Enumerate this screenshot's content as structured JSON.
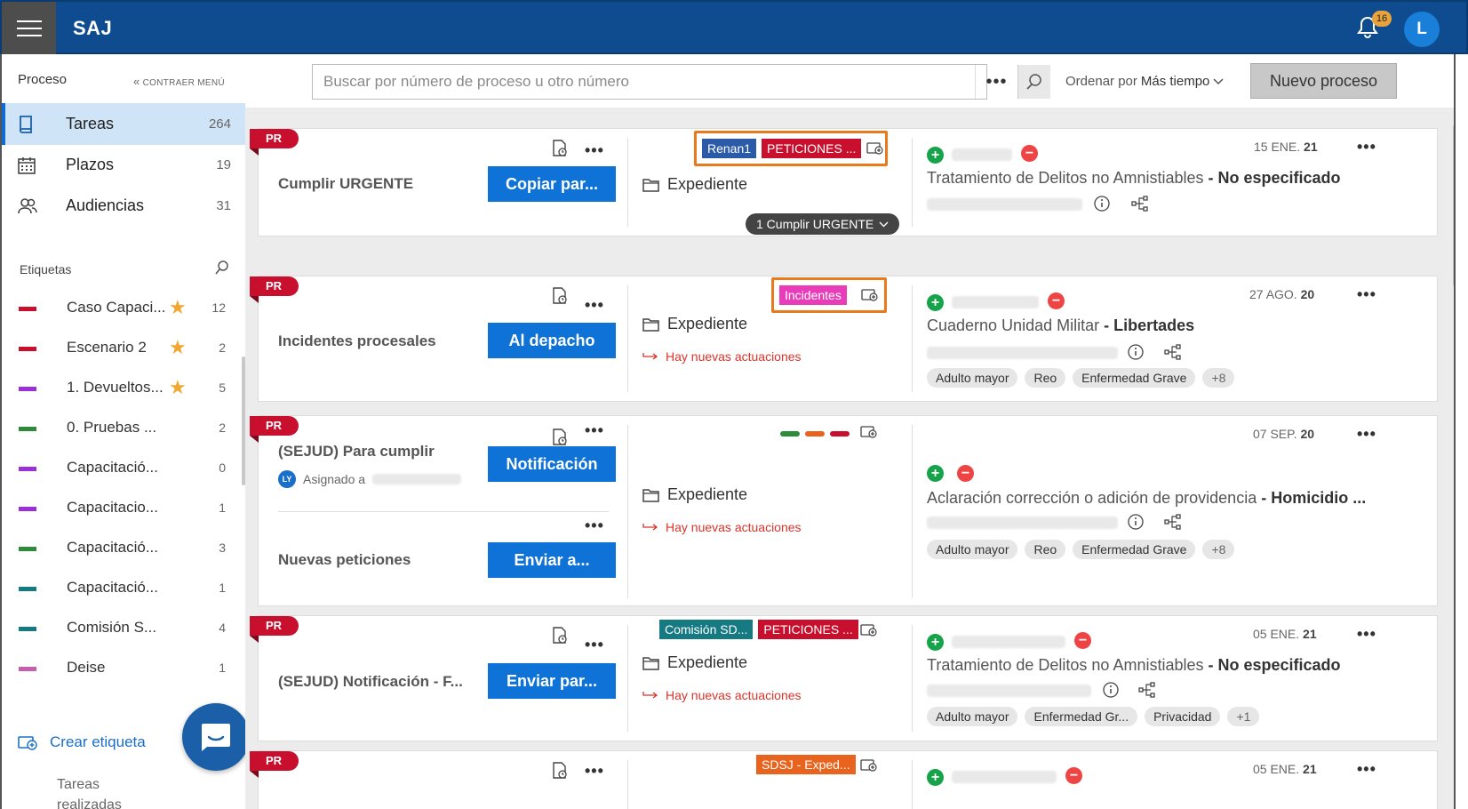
{
  "app": {
    "brand": "SAJ",
    "notifications": "16",
    "user_initial": "L"
  },
  "sidebar": {
    "title": "Proceso",
    "collapse": "CONTRAER MENÚ",
    "nav": [
      {
        "label": "Tareas",
        "count": "264"
      },
      {
        "label": "Plazos",
        "count": "19"
      },
      {
        "label": "Audiencias",
        "count": "31"
      }
    ],
    "etiquetas_title": "Etiquetas",
    "tags": [
      {
        "label": "Caso Capaci...",
        "count": "12",
        "color": "#c8102e",
        "star": true
      },
      {
        "label": "Escenario 2",
        "count": "2",
        "color": "#c8102e",
        "star": true
      },
      {
        "label": "1. Devueltos...",
        "count": "5",
        "color": "#9b30d9",
        "star": true
      },
      {
        "label": "0. Pruebas ...",
        "count": "2",
        "color": "#2e8b3a",
        "star": false
      },
      {
        "label": "Capacitació...",
        "count": "0",
        "color": "#9b30d9",
        "star": false
      },
      {
        "label": "Capacitacio...",
        "count": "1",
        "color": "#9b30d9",
        "star": false
      },
      {
        "label": "Capacitació...",
        "count": "3",
        "color": "#2e8b3a",
        "star": false
      },
      {
        "label": "Capacitació...",
        "count": "1",
        "color": "#167a82",
        "star": false
      },
      {
        "label": "Comisión S...",
        "count": "4",
        "color": "#167a82",
        "star": false
      },
      {
        "label": "Deise",
        "count": "1",
        "color": "#c45fb0",
        "star": false
      }
    ],
    "crear": "Crear etiqueta",
    "realizadas": "Tareas realizadas"
  },
  "toolbar": {
    "search_placeholder": "Buscar por número de proceso u otro número",
    "order_prefix": "Ordenar por",
    "order_value": "Más tiempo",
    "new_process": "Nuevo proceso"
  },
  "cards": [
    {
      "badge": "PR",
      "task": "Cumplir URGENTE",
      "action": "Copiar par...",
      "labels": [
        {
          "text": "Renan1",
          "color": "#2a5aa8"
        },
        {
          "text": "PETICIONES ...",
          "color": "#c8102e"
        }
      ],
      "expediente": "Expediente",
      "pill": "1 Cumplir URGENTE",
      "date_day": "15 ENE.",
      "date_year": "21",
      "title": "Tratamiento de Delitos no Amnistiables",
      "subtitle": "- No especificado"
    },
    {
      "badge": "PR",
      "task": "Incidentes procesales",
      "action": "Al depacho",
      "labels": [
        {
          "text": "Incidentes",
          "color": "#e83cb8"
        }
      ],
      "expediente": "Expediente",
      "nuevas": "Hay nuevas actuaciones",
      "date_day": "27 AGO.",
      "date_year": "20",
      "title": "Cuaderno Unidad Militar",
      "subtitle": "- Libertades",
      "chips": [
        "Adulto mayor",
        "Reo",
        "Enfermedad Grave",
        "+8"
      ]
    },
    {
      "badge": "PR",
      "task": "(SEJUD) Para cumplir",
      "assigned": "Asignado a",
      "assigned_initials": "LY",
      "action": "Notificación",
      "task2": "Nuevas peticiones",
      "action2": "Enviar a...",
      "bars": [
        "#2e8b3a",
        "#e8631e",
        "#c8102e"
      ],
      "expediente": "Expediente",
      "nuevas": "Hay nuevas actuaciones",
      "date_day": "07 SEP.",
      "date_year": "20",
      "title": "Aclaración corrección o adición de providencia",
      "subtitle": "- Homicidio ...",
      "chips": [
        "Adulto mayor",
        "Reo",
        "Enfermedad Grave",
        "+8"
      ]
    },
    {
      "badge": "PR",
      "task": "(SEJUD) Notificación - F...",
      "action": "Enviar par...",
      "labels": [
        {
          "text": "Comisión SD...",
          "color": "#167a82"
        },
        {
          "text": "PETICIONES ...",
          "color": "#c8102e"
        }
      ],
      "expediente": "Expediente",
      "nuevas": "Hay nuevas actuaciones",
      "date_day": "05 ENE.",
      "date_year": "21",
      "title": "Tratamiento de Delitos no Amnistiables",
      "subtitle": "- No especificado",
      "chips": [
        "Adulto mayor",
        "Enfermedad Gr...",
        "Privacidad",
        "+1"
      ]
    },
    {
      "badge": "PR",
      "labels": [
        {
          "text": "SDSJ - Exped...",
          "color": "#e8631e"
        }
      ],
      "date_day": "05 ENE.",
      "date_year": "21"
    }
  ]
}
